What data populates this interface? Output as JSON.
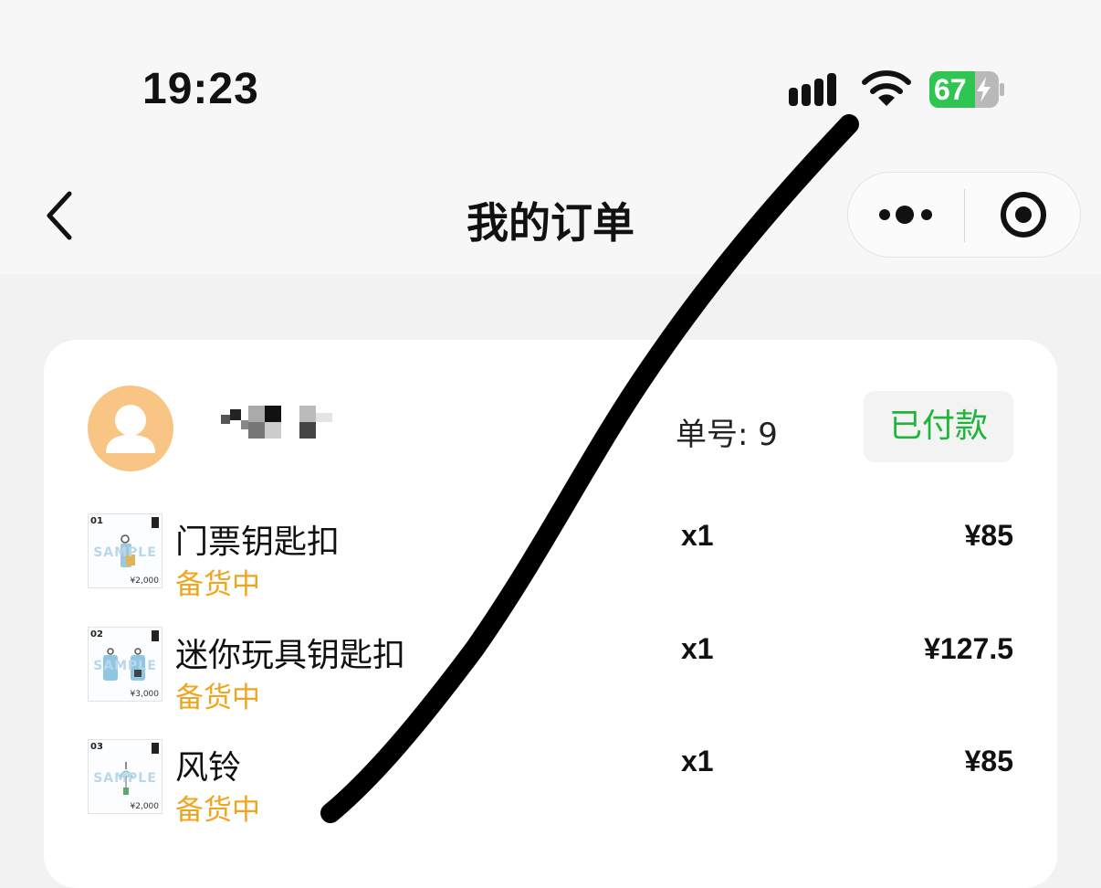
{
  "status_bar": {
    "time": "19:23",
    "battery_level": "67"
  },
  "nav": {
    "title": "我的订单"
  },
  "order": {
    "order_no": "单号: 9",
    "status": "已付款",
    "items": [
      {
        "name": "门票钥匙扣",
        "status": "备货中",
        "qty": "x1",
        "price": "¥85",
        "thumb": {
          "tag": "01",
          "sample": "SAMPLE",
          "price": "¥2,000"
        }
      },
      {
        "name": "迷你玩具钥匙扣",
        "status": "备货中",
        "qty": "x1",
        "price": "¥127.5",
        "thumb": {
          "tag": "02",
          "sample": "SAMPLE",
          "price": "¥3,000"
        }
      },
      {
        "name": "风铃",
        "status": "备货中",
        "qty": "x1",
        "price": "¥85",
        "thumb": {
          "tag": "03",
          "sample": "SAMPLE",
          "price": "¥2,000"
        }
      }
    ]
  },
  "colors": {
    "paid_green": "#1fb53b",
    "stocking_orange": "#f0a51e",
    "avatar_bg": "#f9c584"
  },
  "icons": [
    "signal-icon",
    "wifi-icon",
    "battery-icon",
    "back-arrow-icon",
    "more-icon",
    "close-target-icon",
    "avatar-icon"
  ]
}
